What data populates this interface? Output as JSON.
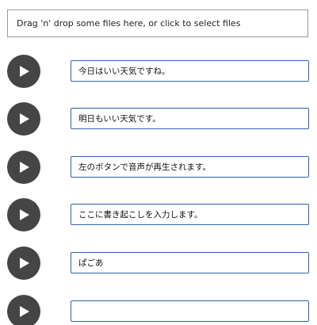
{
  "dropzone": {
    "label": "Drag 'n' drop some files here, or click to select files"
  },
  "rows": [
    {
      "text": "今日はいい天気ですね。"
    },
    {
      "text": "明日もいい天気です。"
    },
    {
      "text": "左のボタンで音声が再生されます。"
    },
    {
      "text": "ここに書き起こしを入力します。"
    },
    {
      "text": "ぱごあ"
    },
    {
      "text": ""
    }
  ],
  "icons": {
    "play": "play-icon"
  },
  "colors": {
    "play_button_bg": "#454545",
    "input_border": "#2f64b0"
  }
}
